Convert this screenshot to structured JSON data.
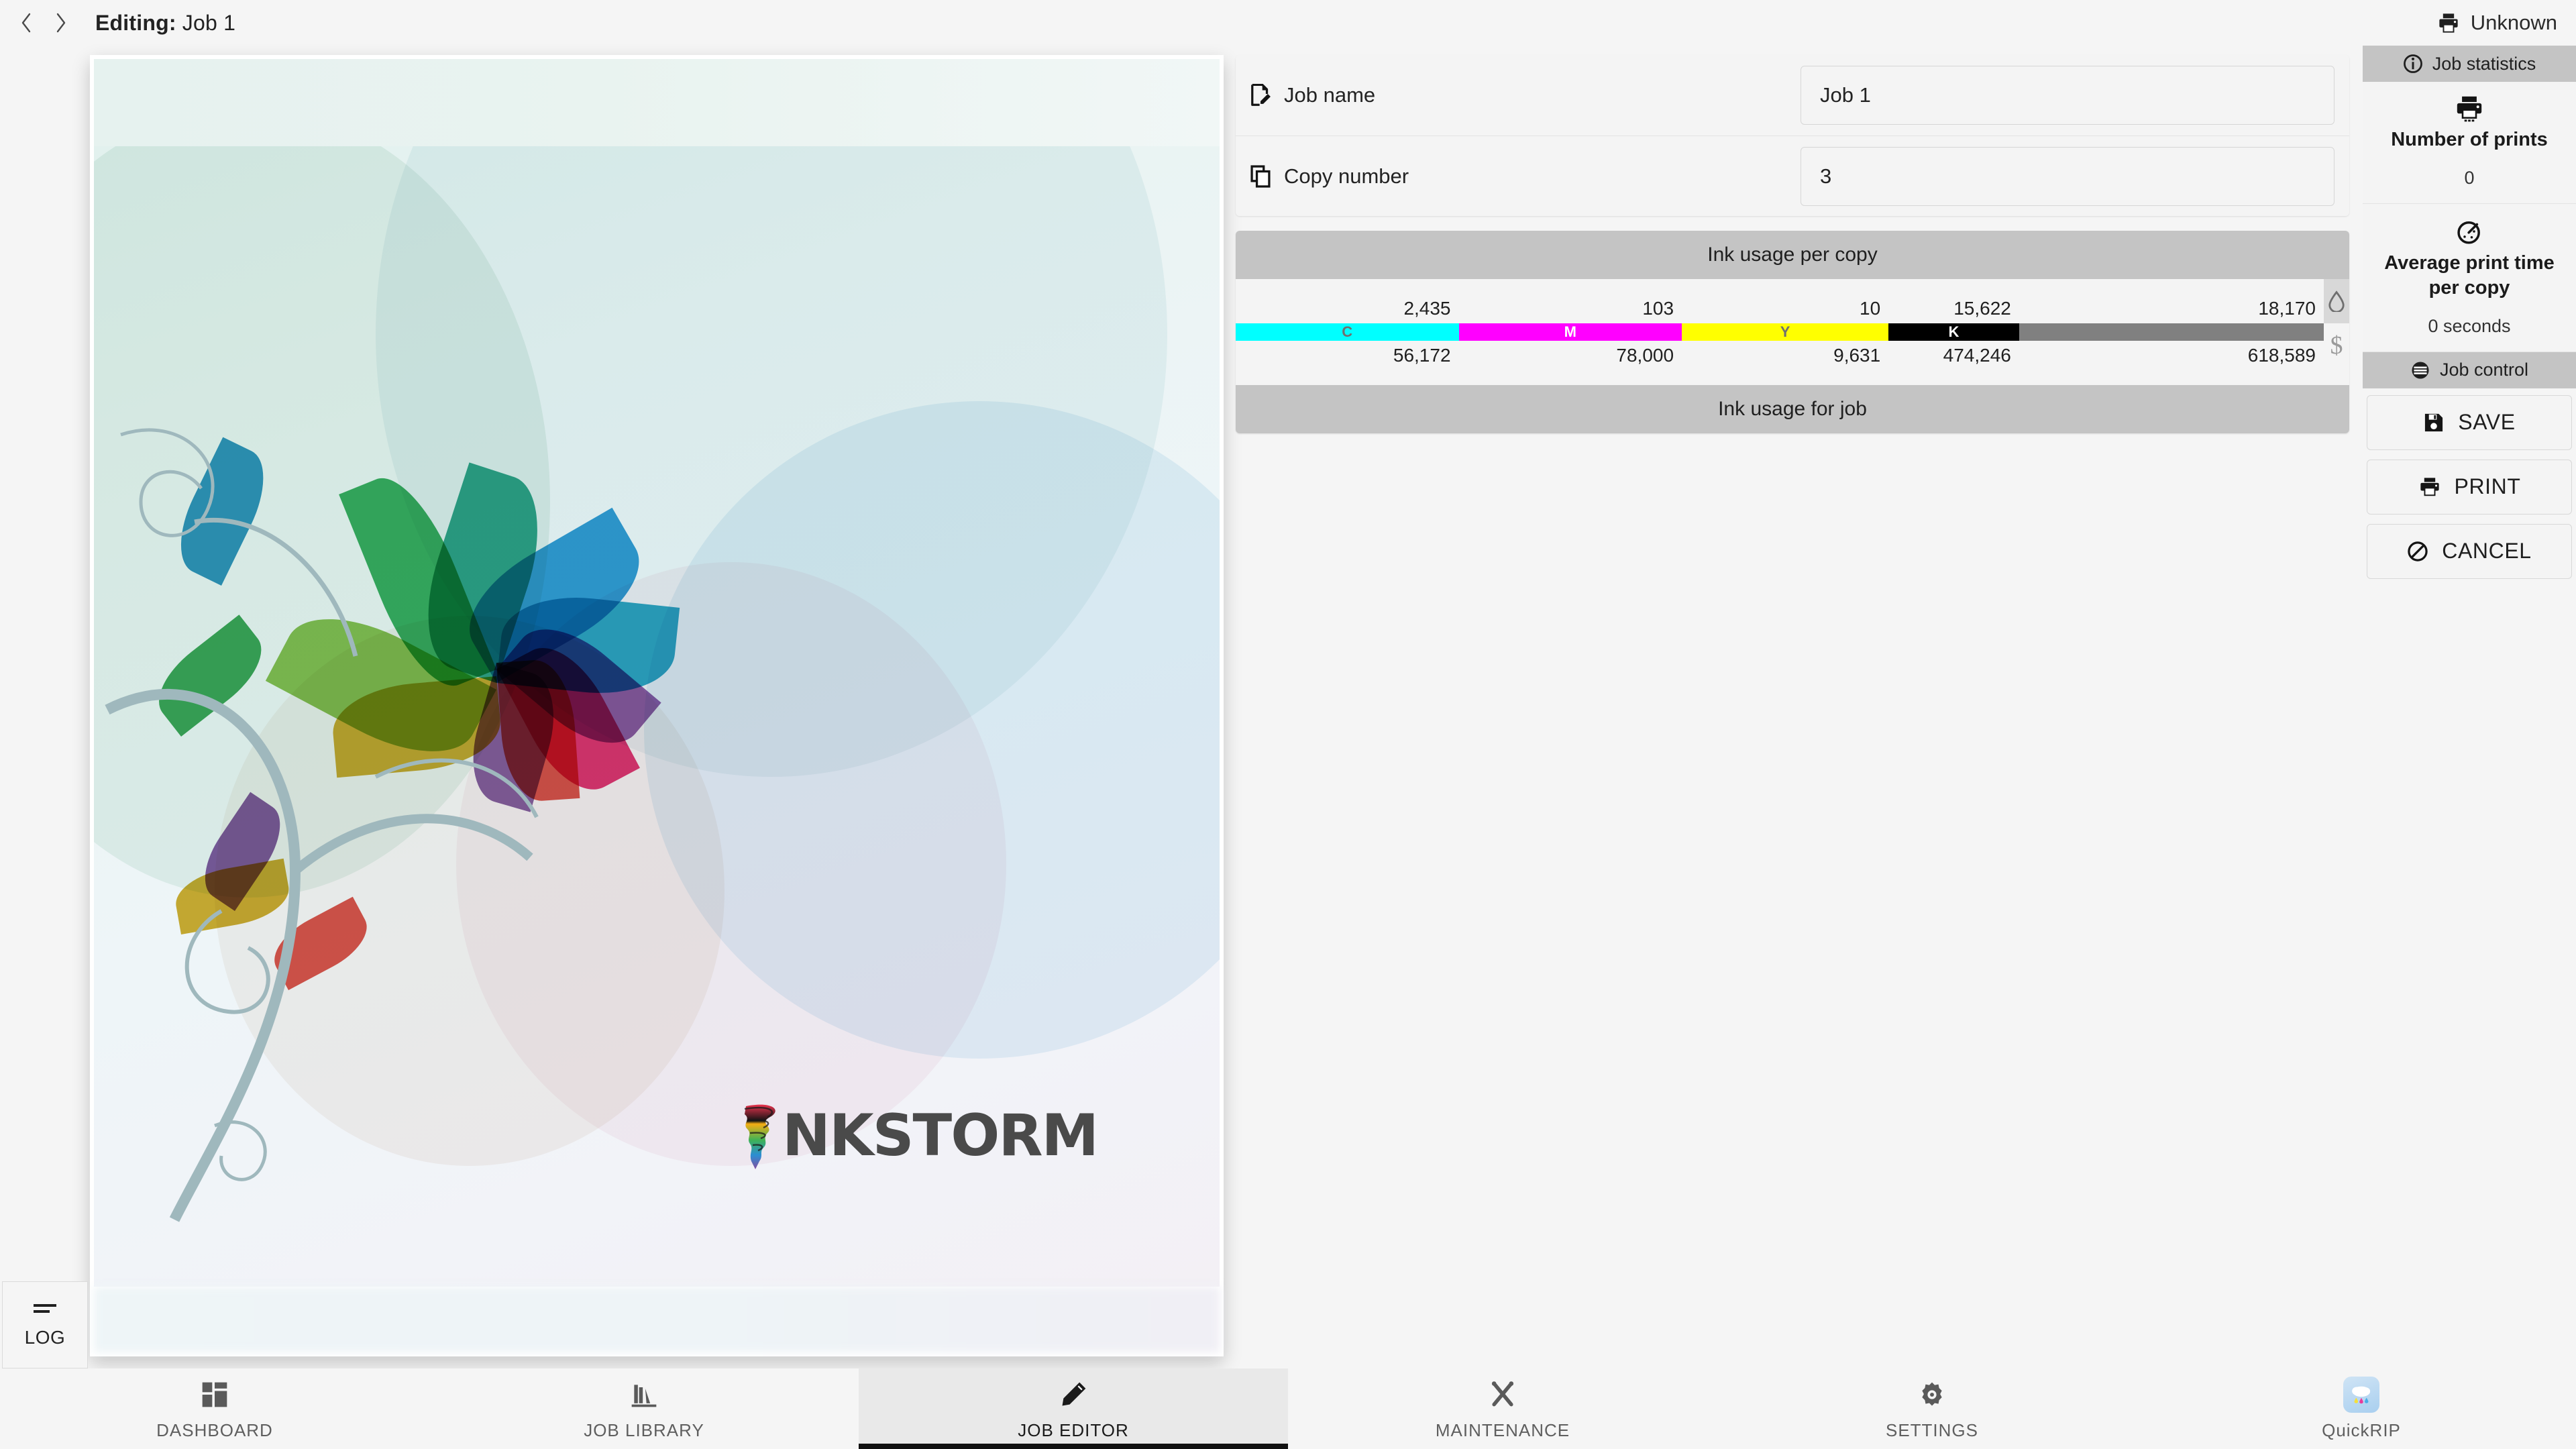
{
  "header": {
    "back_icon": "chevron-left-icon",
    "forward_icon": "chevron-right-icon",
    "title_prefix": "Editing:",
    "title_value": "Job 1",
    "printer_icon": "printer-icon",
    "printer_status": "Unknown"
  },
  "log_button": {
    "label": "LOG",
    "icon": "list-icon"
  },
  "preview": {
    "logo_text": "NKSTORM",
    "alt": "job-preview-artwork"
  },
  "fields": [
    {
      "icon": "document-edit-icon",
      "label": "Job name",
      "value": "Job 1",
      "placeholder": "Job name"
    },
    {
      "icon": "copy-icon",
      "label": "Copy number",
      "value": "3",
      "placeholder": "Copy number"
    }
  ],
  "ink_usage": {
    "header_per_copy": "Ink usage per copy",
    "header_for_job": "Ink usage for job",
    "volume_unit_icon": "ink-drop-icon",
    "cost_unit_icon": "dollar-icon",
    "channels": [
      {
        "code": "C",
        "color": "#00ffff",
        "label_color": "#707070",
        "per_copy": "2,435",
        "for_job": "56,172",
        "width_pct": 20.5
      },
      {
        "code": "M",
        "color": "#ff00ff",
        "label_color": "#ffffff",
        "per_copy": "103",
        "for_job": "78,000",
        "width_pct": 20.5
      },
      {
        "code": "Y",
        "color": "#ffff00",
        "label_color": "#707070",
        "per_copy": "10",
        "for_job": "9,631",
        "width_pct": 19.0
      },
      {
        "code": "K",
        "color": "#000000",
        "label_color": "#ffffff",
        "per_copy": "15,622",
        "for_job": "474,246",
        "width_pct": 12.0
      },
      {
        "code": "",
        "color": "#808080",
        "label_color": "#ffffff",
        "per_copy": "18,170",
        "for_job": "618,589",
        "width_pct": 28.0
      }
    ]
  },
  "job_statistics": {
    "section_title": "Job statistics",
    "section_icon": "info-icon",
    "items": [
      {
        "icon": "printer-icon",
        "name": "Number of prints",
        "value": "0"
      },
      {
        "icon": "timer-icon",
        "name": "Average print time per copy",
        "value": "0 seconds"
      }
    ]
  },
  "job_control": {
    "section_title": "Job control",
    "section_icon": "menu-icon",
    "buttons": [
      {
        "icon": "save-icon",
        "label": "SAVE"
      },
      {
        "icon": "printer-icon",
        "label": "PRINT"
      },
      {
        "icon": "cancel-icon",
        "label": "CANCEL"
      }
    ]
  },
  "bottom_nav": [
    {
      "icon": "dashboard-icon",
      "label": "DASHBOARD",
      "active": false
    },
    {
      "icon": "library-icon",
      "label": "JOB LIBRARY",
      "active": false
    },
    {
      "icon": "pencil-icon",
      "label": "JOB EDITOR",
      "active": true
    },
    {
      "icon": "tools-icon",
      "label": "MAINTENANCE",
      "active": false
    },
    {
      "icon": "gear-icon",
      "label": "SETTINGS",
      "active": false
    },
    {
      "icon": "quickrip-icon",
      "label": "QuickRIP",
      "active": false
    }
  ],
  "colors": {
    "app_bg": "#f5f5f5",
    "panel_bg": "#f4f4f4",
    "section_header_bg": "#c4c4c4",
    "active_tab_bg": "#e9e9e9",
    "cyan": "#00ffff",
    "magenta": "#ff00ff",
    "yellow": "#ffff00",
    "black": "#000000",
    "total_gray": "#808080"
  }
}
